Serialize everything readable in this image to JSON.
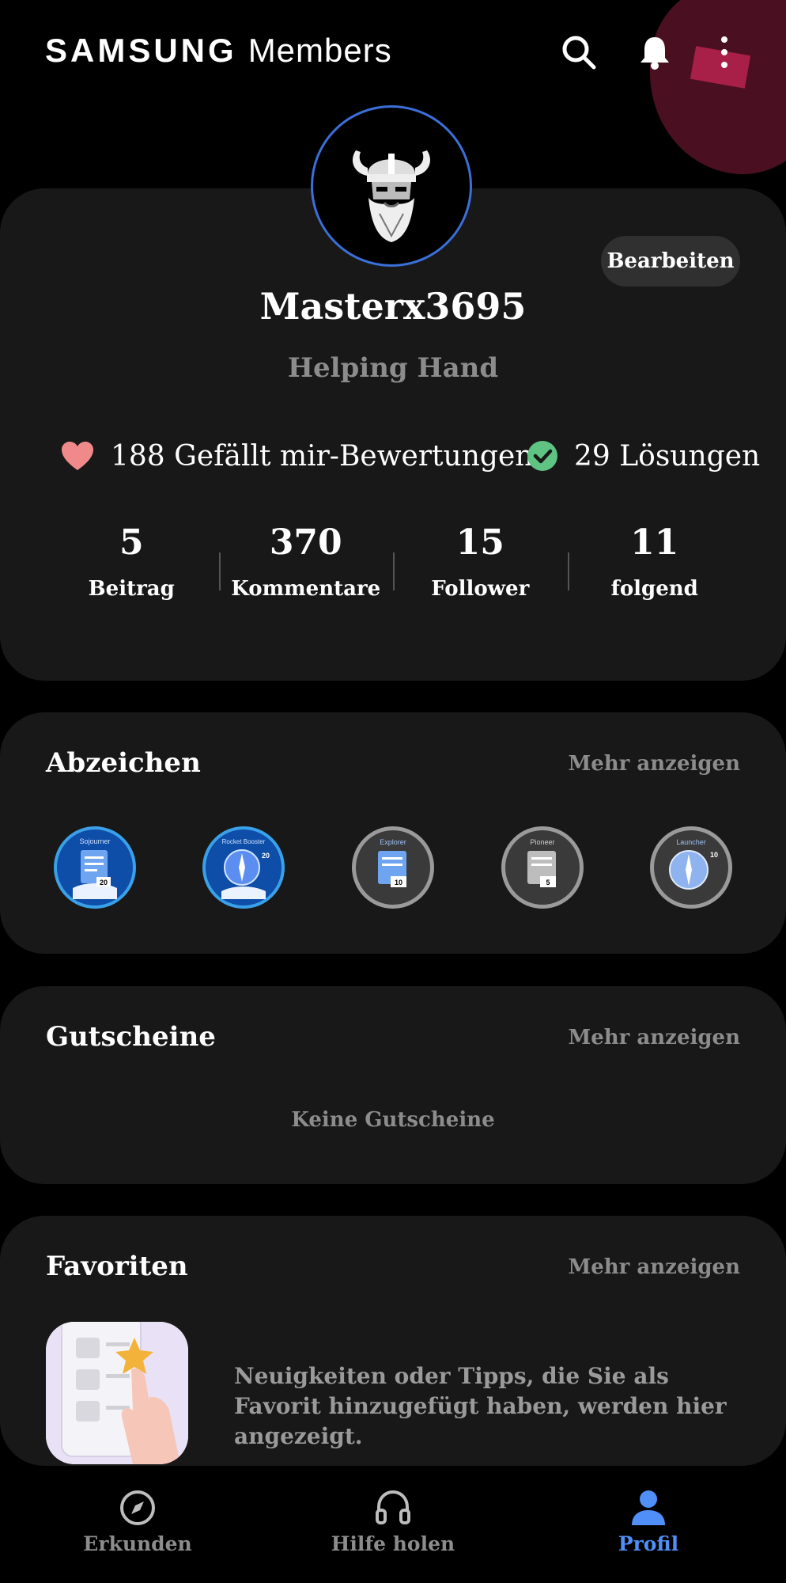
{
  "app": {
    "brand_bold": "SAMSUNG",
    "brand_light": "Members"
  },
  "profile": {
    "edit_label": "Bearbeiten",
    "username": "Masterx3695",
    "rank": "Helping Hand",
    "likes": "188 Gefällt mir-Bewertungen",
    "solutions": "29 Lösungen",
    "counts": [
      {
        "value": "5",
        "label": "Beitrag"
      },
      {
        "value": "370",
        "label": "Kommentare"
      },
      {
        "value": "15",
        "label": "Follower"
      },
      {
        "value": "11",
        "label": "folgend"
      }
    ]
  },
  "badges": {
    "title": "Abzeichen",
    "more": "Mehr anzeigen",
    "items": [
      {
        "name": "Sojourner",
        "level": "20",
        "color": "#1b63c9"
      },
      {
        "name": "Rocket Booster",
        "level": "20",
        "color": "#1b63c9"
      },
      {
        "name": "Explorer",
        "level": "10",
        "color": "#5a5a5a"
      },
      {
        "name": "Pioneer",
        "level": "5",
        "color": "#5a5a5a"
      },
      {
        "name": "Launcher",
        "level": "10",
        "color": "#5a5a5a"
      }
    ]
  },
  "vouchers": {
    "title": "Gutscheine",
    "more": "Mehr anzeigen",
    "empty": "Keine Gutscheine"
  },
  "favorites": {
    "title": "Favoriten",
    "more": "Mehr anzeigen",
    "empty": "Neuigkeiten oder Tipps, die Sie als Favorit hinzugefügt haben, werden hier angezeigt."
  },
  "nav": [
    {
      "label": "Erkunden",
      "icon": "compass-icon",
      "active": false
    },
    {
      "label": "Hilfe holen",
      "icon": "headset-icon",
      "active": false
    },
    {
      "label": "Profil",
      "icon": "person-icon",
      "active": true
    }
  ],
  "colors": {
    "accent": "#4f8ff7",
    "like": "#f08a8a",
    "solution": "#5fc482",
    "card": "#181818"
  }
}
